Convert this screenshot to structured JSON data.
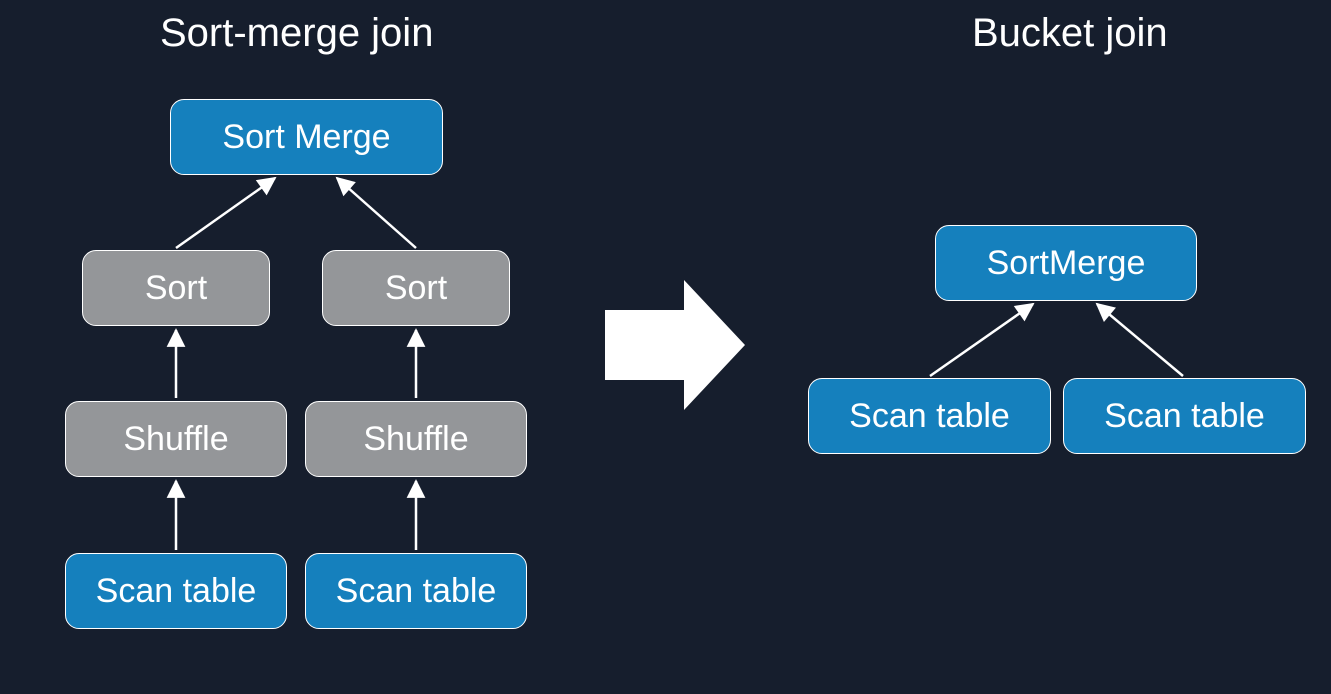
{
  "colors": {
    "bg": "#161e2d",
    "blue": "#1580bd",
    "gray": "#949699",
    "white": "#ffffff"
  },
  "left": {
    "title": "Sort-merge join",
    "root": "Sort Merge",
    "sort": "Sort",
    "shuffle": "Shuffle",
    "scan": "Scan table"
  },
  "right": {
    "title": "Bucket join",
    "root": "SortMerge",
    "scan": "Scan table"
  }
}
